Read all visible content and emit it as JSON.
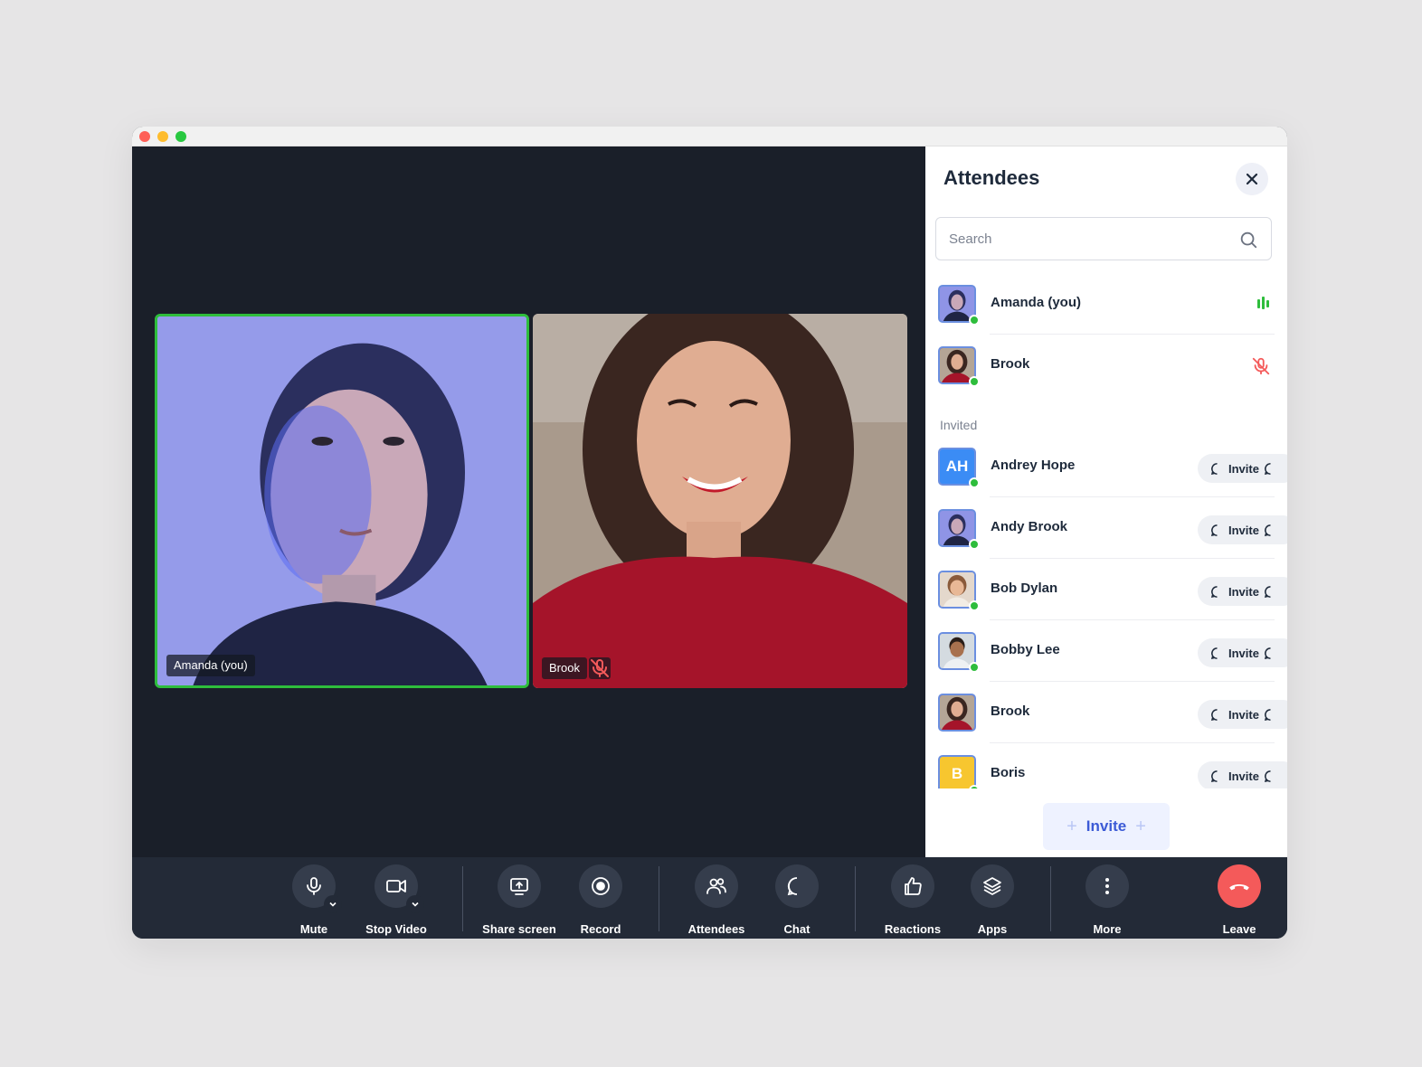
{
  "panel": {
    "title": "Attendees",
    "search_placeholder": "Search",
    "invited_label": "Invited",
    "invite_button": "Invite"
  },
  "tiles": {
    "amanda": "Amanda (you)",
    "brook": "Brook"
  },
  "attendees": [
    {
      "name": "Amanda (you)",
      "status": "speaking"
    },
    {
      "name": "Brook",
      "status": "muted"
    }
  ],
  "invited": [
    {
      "name": "Andrey Hope",
      "initials": "AH",
      "action": "Invite"
    },
    {
      "name": "Andy Brook",
      "action": "Invite"
    },
    {
      "name": "Bob Dylan",
      "action": "Invite"
    },
    {
      "name": "Bobby Lee",
      "action": "Invite"
    },
    {
      "name": "Brook",
      "action": "Invite"
    },
    {
      "name": "Boris",
      "initials": "B",
      "action": "Invite"
    }
  ],
  "toolbar": {
    "mute": "Mute",
    "stop_video": "Stop Video",
    "share_screen": "Share screen",
    "record": "Record",
    "attendees": "Attendees",
    "chat": "Chat",
    "reactions": "Reactions",
    "apps": "Apps",
    "more": "More",
    "leave": "Leave"
  },
  "colors": {
    "accent_green": "#2ebd3c",
    "leave_red": "#f45a5a",
    "stage_bg": "#1a1f29",
    "invite_blue": "#3c5bd6"
  }
}
